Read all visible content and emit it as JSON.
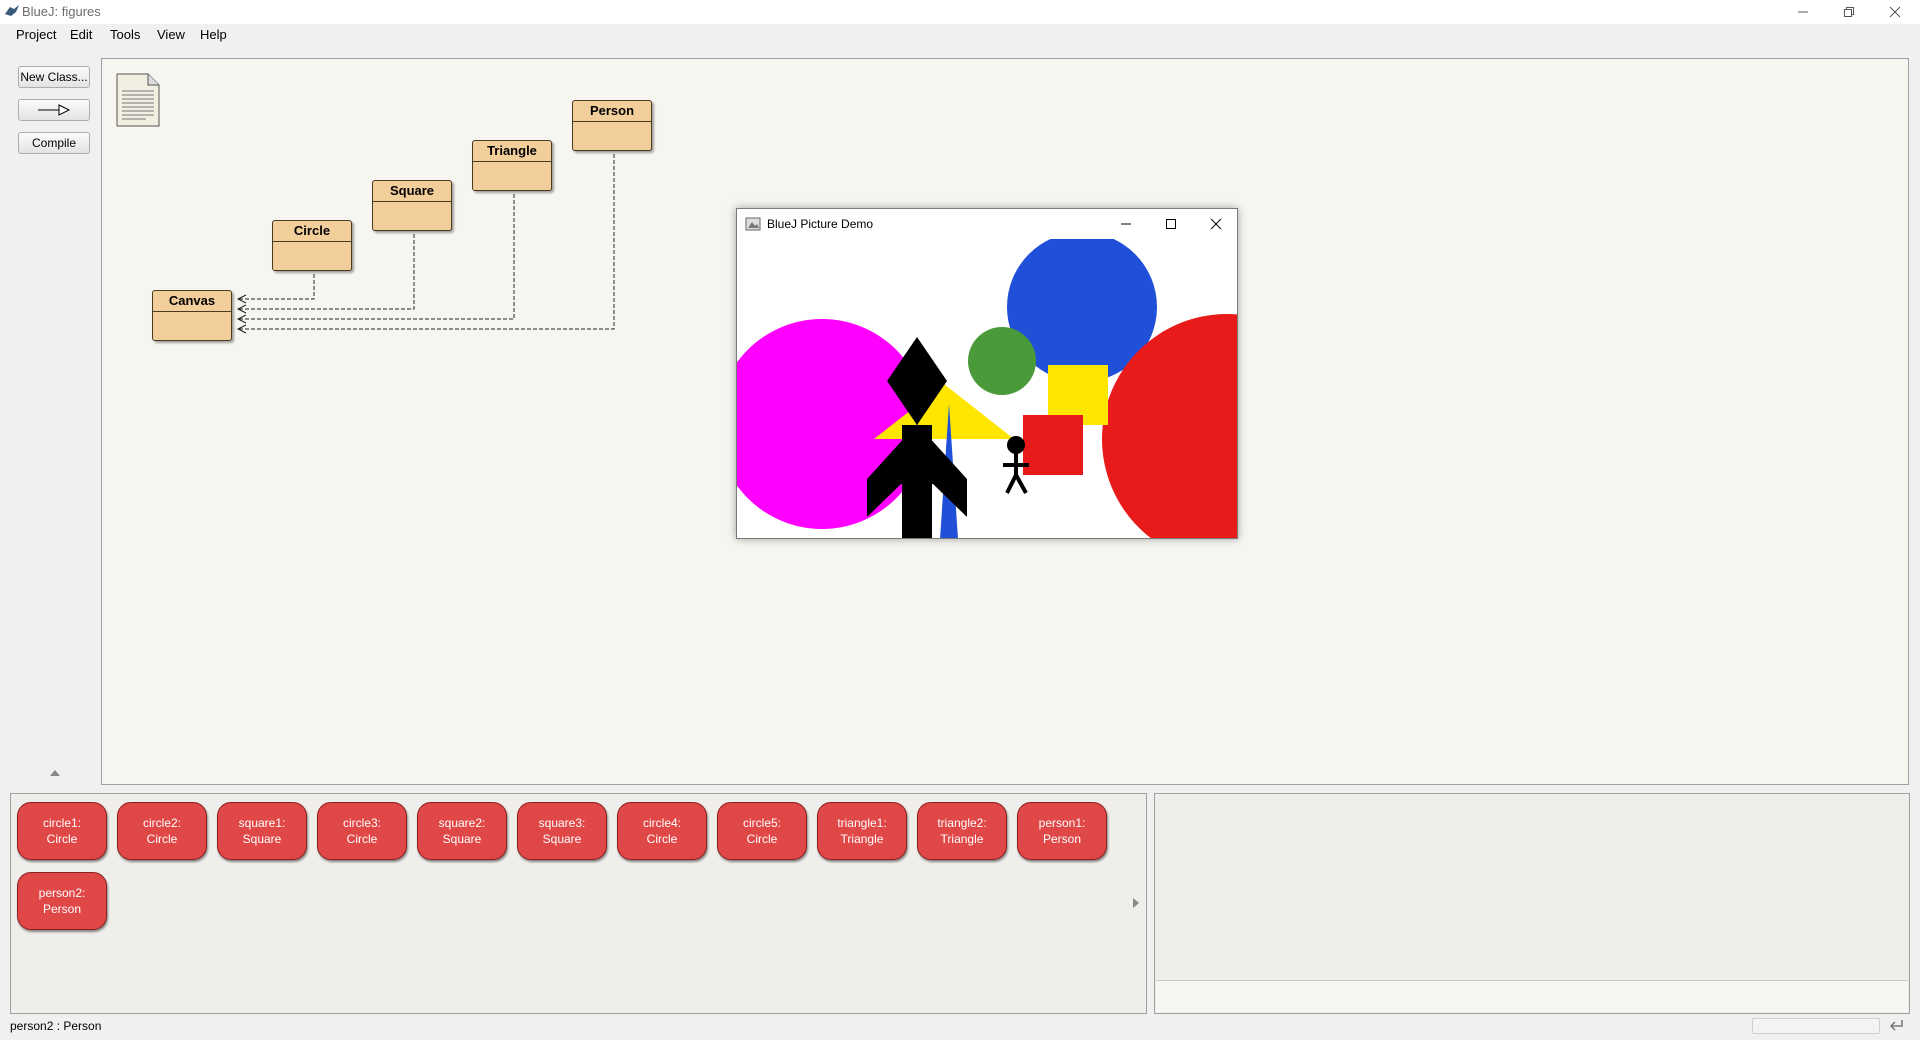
{
  "window": {
    "title": "BlueJ: figures"
  },
  "menu": [
    "Project",
    "Edit",
    "Tools",
    "View",
    "Help"
  ],
  "toolbar": {
    "new_class": "New Class...",
    "arrow_icon": "inherit-arrow-icon",
    "compile": "Compile"
  },
  "classes": [
    "Person",
    "Triangle",
    "Square",
    "Circle",
    "Canvas"
  ],
  "demo": {
    "title": "BlueJ Picture Demo"
  },
  "objects": [
    {
      "name": "circle1:",
      "type": "Circle"
    },
    {
      "name": "circle2:",
      "type": "Circle"
    },
    {
      "name": "square1:",
      "type": "Square"
    },
    {
      "name": "circle3:",
      "type": "Circle"
    },
    {
      "name": "square2:",
      "type": "Square"
    },
    {
      "name": "square3:",
      "type": "Square"
    },
    {
      "name": "circle4:",
      "type": "Circle"
    },
    {
      "name": "circle5:",
      "type": "Circle"
    },
    {
      "name": "triangle1:",
      "type": "Triangle"
    },
    {
      "name": "triangle2:",
      "type": "Triangle"
    },
    {
      "name": "person1:",
      "type": "Person"
    },
    {
      "name": "person2:",
      "type": "Person"
    }
  ],
  "status": "person2 : Person",
  "colors": {
    "object": "#e04747",
    "class": "#f2ce9b",
    "magenta": "#ff00ff",
    "blue": "#2050d8",
    "red": "#e81a1a",
    "green": "#4a9a3a",
    "yellow": "#ffe600"
  }
}
